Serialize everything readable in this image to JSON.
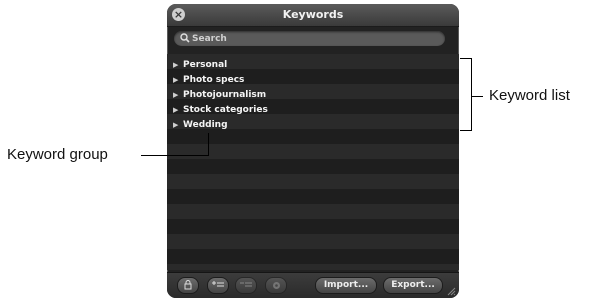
{
  "window": {
    "title": "Keywords"
  },
  "search": {
    "placeholder": "Search"
  },
  "keywords": [
    {
      "label": "Personal"
    },
    {
      "label": "Photo specs"
    },
    {
      "label": "Photojournalism"
    },
    {
      "label": "Stock categories"
    },
    {
      "label": "Wedding"
    }
  ],
  "toolbar": {
    "import_label": "Import...",
    "export_label": "Export..."
  },
  "annotations": {
    "keyword_list": "Keyword list",
    "keyword_group": "Keyword group"
  }
}
